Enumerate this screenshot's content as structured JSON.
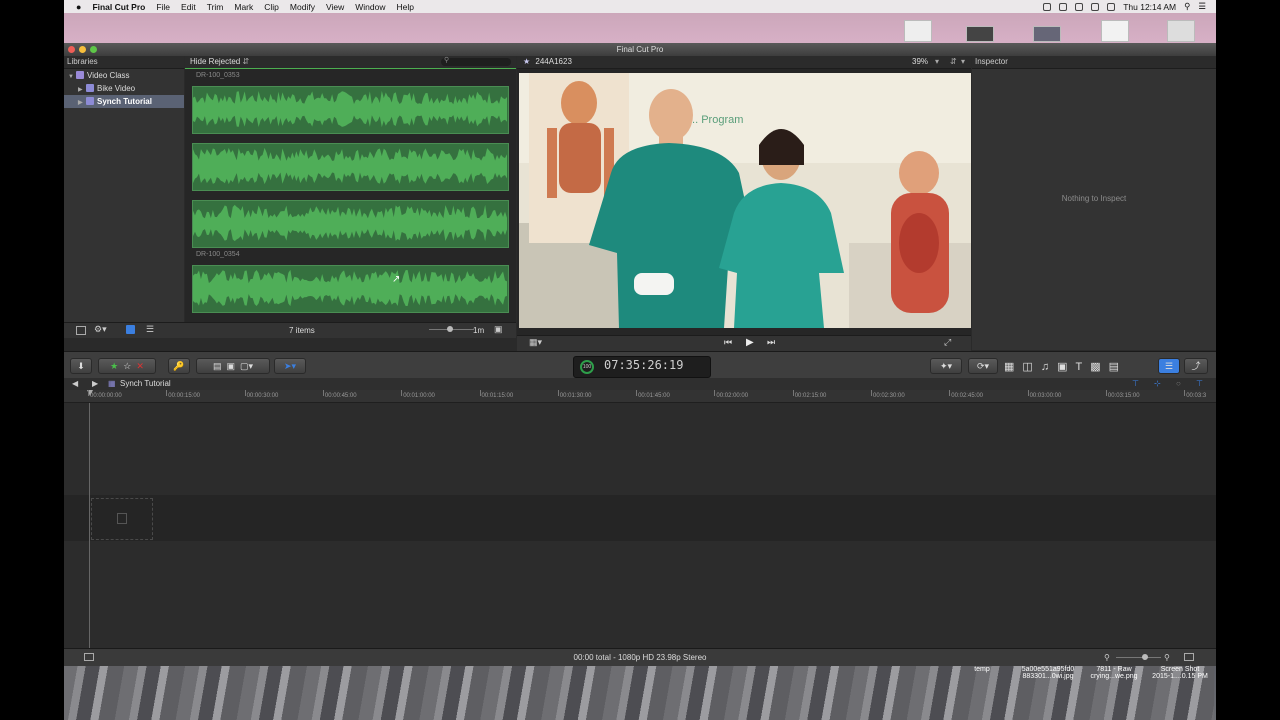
{
  "menubar": {
    "app_name": "Final Cut Pro",
    "items": [
      "File",
      "Edit",
      "Trim",
      "Mark",
      "Clip",
      "Modify",
      "View",
      "Window",
      "Help"
    ],
    "clock": "Thu 12:14 AM"
  },
  "window": {
    "title": "Final Cut Pro"
  },
  "libraries": {
    "header": "Libraries",
    "items": [
      {
        "label": "Video Class"
      },
      {
        "label": "Bike Video"
      },
      {
        "label": "Synch Tutorial"
      }
    ]
  },
  "browser": {
    "filter": "Hide Rejected",
    "clip_names": [
      "DR-100_0353",
      "DR-100_0354"
    ],
    "item_count": "7 items",
    "duration": "1m"
  },
  "viewer": {
    "clip_name": "244A1623",
    "zoom": "39%",
    "whiteboard_text": "... Program"
  },
  "inspector": {
    "header": "Inspector",
    "empty_text": "Nothing to Inspect"
  },
  "toolbar": {
    "timecode": "07:35:26:19",
    "timecode_badge": "100"
  },
  "timeline": {
    "project_name": "Synch Tutorial",
    "ruler": [
      "00:00:00:00",
      "00:00:15:00",
      "00:00:30:00",
      "00:00:45:00",
      "00:01:00:00",
      "00:01:15:00",
      "00:01:30:00",
      "00:01:45:00",
      "00:02:00:00",
      "00:02:15:00",
      "00:02:30:00",
      "00:02:45:00",
      "00:03:00:00",
      "00:03:15:00",
      "00:03:3"
    ]
  },
  "status": {
    "text": "00:00 total - 1080p HD 23.98p Stereo"
  },
  "desktop_files": [
    {
      "line1": "temp",
      "line2": ""
    },
    {
      "line1": "5a00e551a95fd0",
      "line2": "883301...0wi.jpg"
    },
    {
      "line1": "7811 - Raw",
      "line2": "crying...we.png"
    },
    {
      "line1": "Screen Shot",
      "line2": "2015-1....0.15 PM"
    }
  ],
  "colors": {
    "waveform": "#35713f",
    "selection": "#5a6274",
    "accent_blue": "#3b7fe0"
  }
}
